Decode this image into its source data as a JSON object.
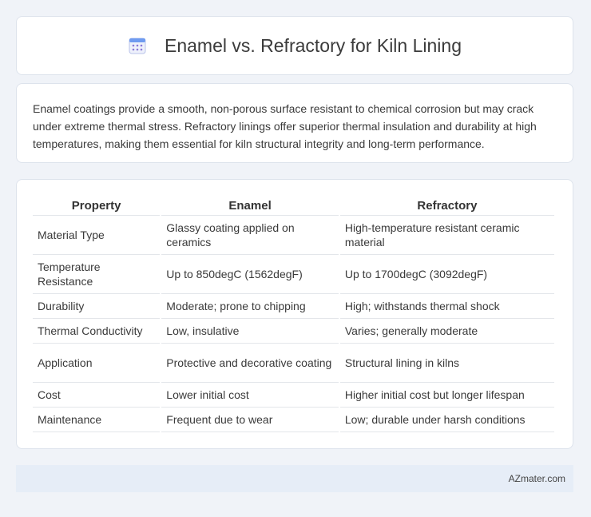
{
  "header": {
    "title": "Enamel vs. Refractory for Kiln Lining",
    "icon": "calendar-icon"
  },
  "summary": {
    "text": "Enamel coatings provide a smooth, non-porous surface resistant to chemical corrosion but may crack under extreme thermal stress. Refractory linings offer superior thermal insulation and durability at high temperatures, making them essential for kiln structural integrity and long-term performance."
  },
  "table": {
    "headers": [
      "Property",
      "Enamel",
      "Refractory"
    ],
    "rows": [
      [
        "Material Type",
        "Glassy coating applied on ceramics",
        "High-temperature resistant ceramic material"
      ],
      [
        "Temperature Resistance",
        "Up to 850degC (1562degF)",
        "Up to 1700degC (3092degF)"
      ],
      [
        "Durability",
        "Moderate; prone to chipping",
        "High; withstands thermal shock"
      ],
      [
        "Thermal Conductivity",
        "Low, insulative",
        "Varies; generally moderate"
      ],
      [
        "Application",
        "Protective and decorative coating",
        "Structural lining in kilns"
      ],
      [
        "Cost",
        "Lower initial cost",
        "Higher initial cost but longer lifespan"
      ],
      [
        "Maintenance",
        "Frequent due to wear",
        "Low; durable under harsh conditions"
      ]
    ]
  },
  "footer": {
    "brand": "AZmater.com"
  },
  "colors": {
    "background": "#f0f3f8",
    "footer_bg": "#e6edf7",
    "icon_blue": "#5b8def",
    "icon_purple": "#8a7bd8"
  }
}
